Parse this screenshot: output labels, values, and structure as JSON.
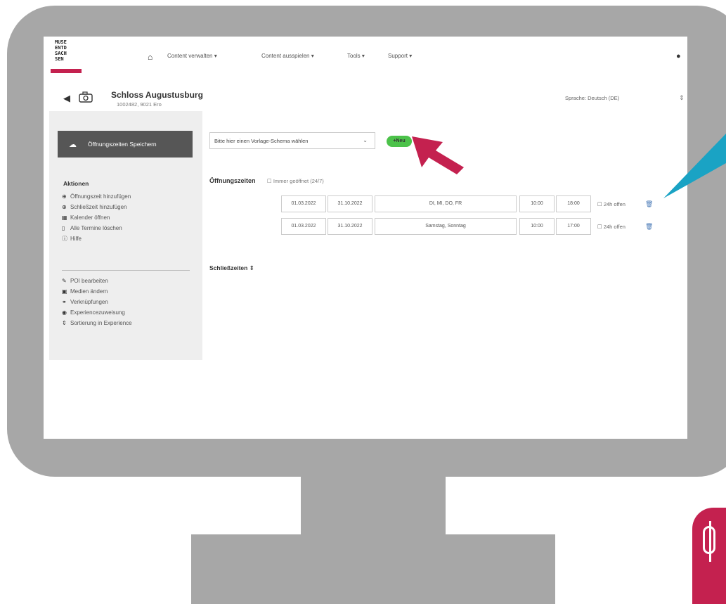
{
  "nav": {
    "logo_lines": [
      "MUSE",
      "ENTD",
      "SACH",
      "SEN"
    ],
    "home_icon": "home-icon",
    "items": [
      {
        "label": "Content verwalten ▾"
      },
      {
        "label": "Content ausspielen ▾"
      },
      {
        "label": "Tools ▾"
      },
      {
        "label": "Support ▾"
      }
    ],
    "user_icon": "user-icon"
  },
  "header": {
    "title": "Schloss Augustusburg",
    "subtitle": "1002482, 9021 Ero",
    "language": "Sprache: Deutsch (DE)",
    "back_icon": "chevron-left-icon",
    "camera_icon": "camera-icon"
  },
  "sidebar": {
    "save_label": "Öffnungszeiten Speichern",
    "actions_heading": "Aktionen",
    "actions": [
      {
        "icon": "plus-circle-icon",
        "label": "Öffnungszeit hinzufügen"
      },
      {
        "icon": "plus-circle-icon",
        "label": "Schließzeit hinzufügen"
      },
      {
        "icon": "calendar-icon",
        "label": "Kalender öffnen"
      },
      {
        "icon": "trash-icon",
        "label": "Alle Termine löschen"
      },
      {
        "icon": "info-icon",
        "label": "Hilfe"
      }
    ],
    "links": [
      {
        "icon": "edit-icon",
        "label": "POI bearbeiten"
      },
      {
        "icon": "image-icon",
        "label": "Medien ändern"
      },
      {
        "icon": "link-icon",
        "label": "Verknüpfungen"
      },
      {
        "icon": "globe-icon",
        "label": "Experiencezuweisung"
      },
      {
        "icon": "sort-icon",
        "label": "Sortierung in Experience"
      }
    ]
  },
  "main": {
    "schema_value": "Bitte hier einen Vorlage-Schema wählen",
    "new_button": "Neu",
    "hours_title": "Öffnungszeiten",
    "hours_toggle": "Immer geöffnet (24/7)",
    "rows": [
      {
        "from": "01.03.2022",
        "to": "31.10.2022",
        "days": "DI, MI, DO, FR",
        "open": "10:00",
        "close": "18:00",
        "allday": "24h offen"
      },
      {
        "from": "01.03.2022",
        "to": "31.10.2022",
        "days": "Samstag, Sonntag",
        "open": "10:00",
        "close": "17:00",
        "allday": "24h offen"
      }
    ],
    "closings_title": "Schließzeiten"
  }
}
